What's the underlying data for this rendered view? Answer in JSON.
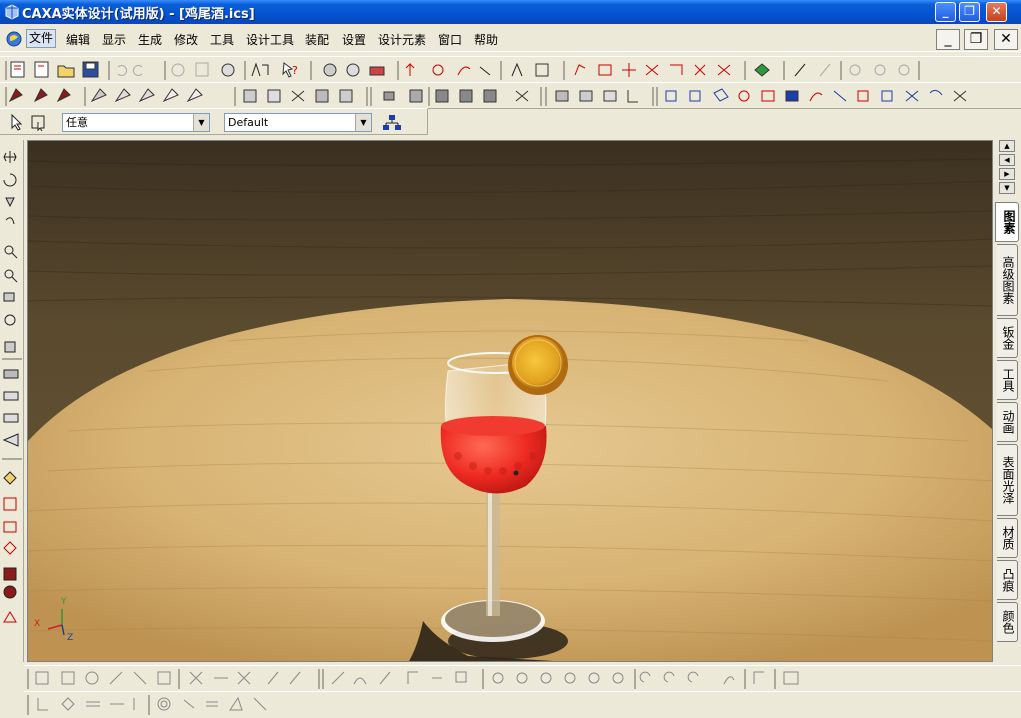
{
  "window": {
    "title": "CAXA实体设计(试用版) - [鸡尾酒.ics]",
    "minimize": "_",
    "restore": "❐",
    "close": "✕"
  },
  "menubar": {
    "items": [
      "文件",
      "编辑",
      "显示",
      "生成",
      "修改",
      "工具",
      "设计工具",
      "装配",
      "设置",
      "设计元素",
      "窗口",
      "帮助"
    ],
    "mdi_minimize": "_",
    "mdi_restore": "❐",
    "mdi_close": "✕"
  },
  "selection_bar": {
    "filter_value": "任意",
    "config_value": "Default"
  },
  "right_tabs": [
    "图素",
    "高级图素",
    "钣金",
    "工具",
    "动画",
    "表面光泽",
    "材质",
    "凸痕",
    "颜色"
  ],
  "viewport": {
    "axis_labels": [
      "X",
      "Y",
      "Z"
    ]
  },
  "colors": {
    "titlebar": "#0453D0",
    "chrome": "#ECE9D8",
    "wood_light": "#D8B477",
    "wood_dark": "#4E3D22",
    "drink_red": "#EE2A22",
    "lemon": "#E8A822"
  }
}
